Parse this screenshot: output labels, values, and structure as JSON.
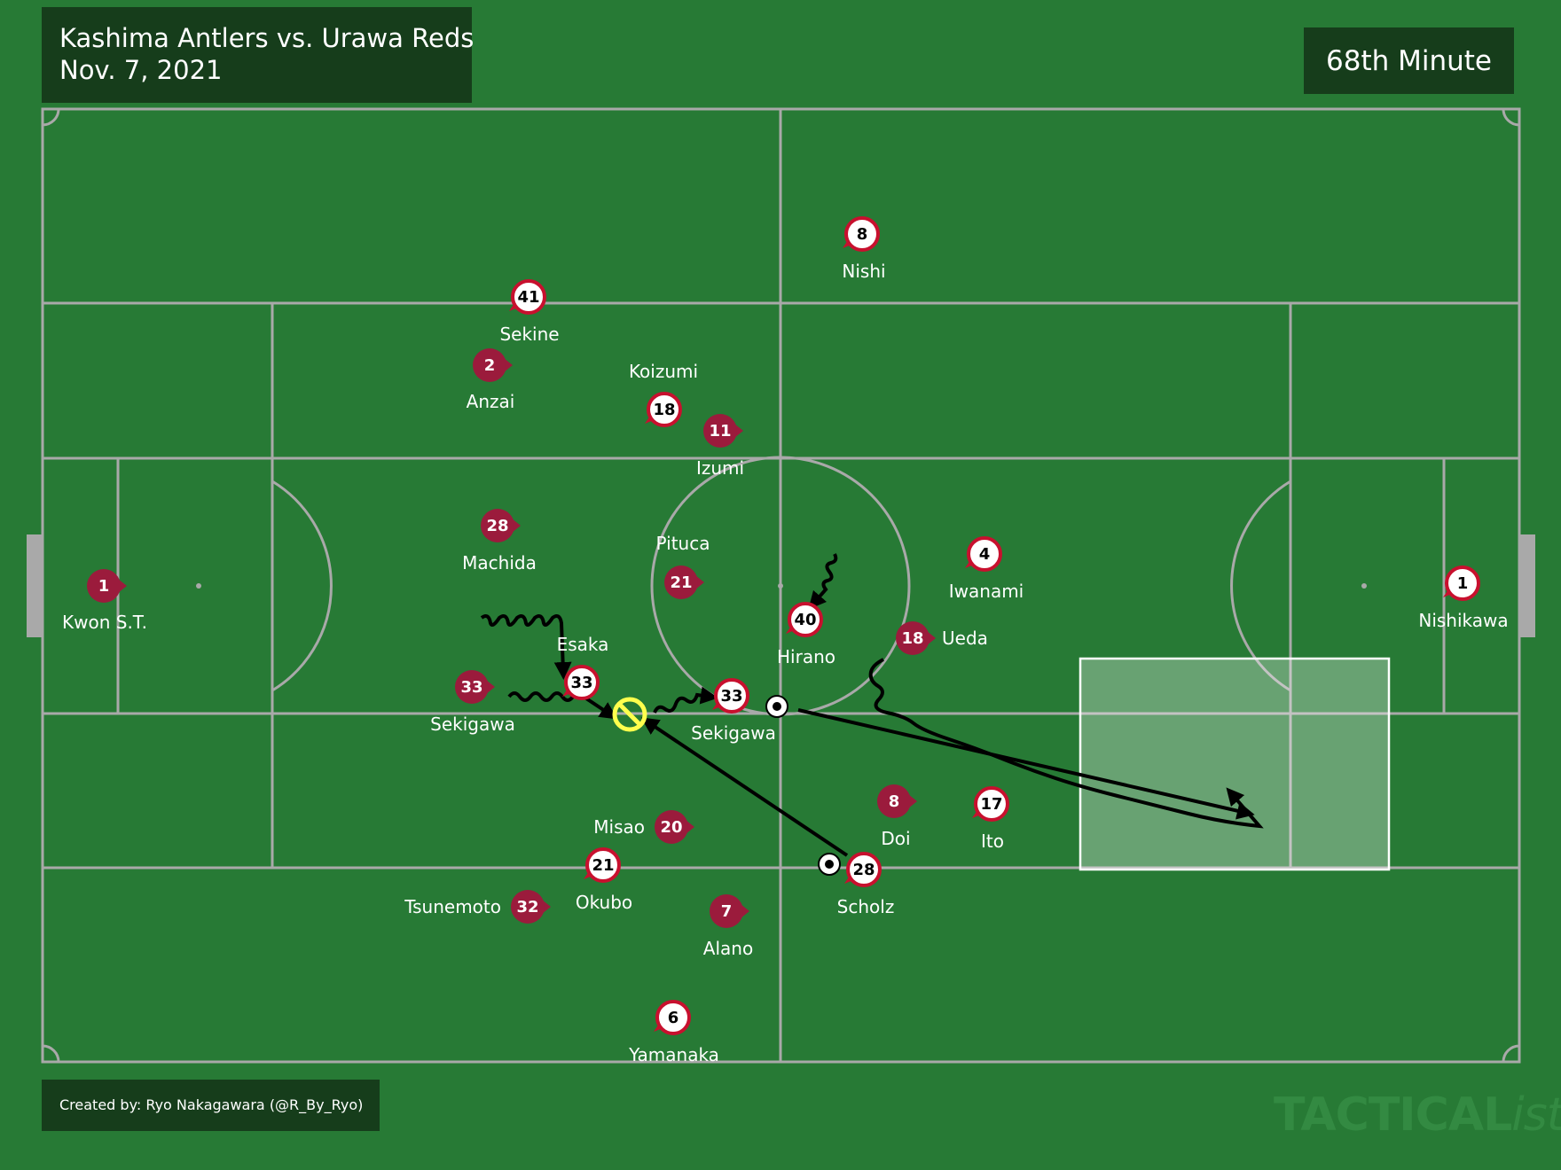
{
  "header": {
    "match": "Kashima Antlers vs. Urawa Reds",
    "date": "Nov. 7, 2021",
    "minute": "68th Minute"
  },
  "footer": {
    "credit": "Created by: Ryo Nakagawara (@R_By_Ryo)",
    "watermark_main": "TACTICAL",
    "watermark_suffix": "ista"
  },
  "colors": {
    "grass": "#277a35",
    "lines": "#a9a9a9",
    "panel": "#163d1b",
    "kashima": "#9b1b3c",
    "urawa_fill": "#ffffff",
    "urawa_ring": "#c8102e",
    "highlight": "#ffff4d"
  },
  "kashima": [
    {
      "number": "1",
      "name": "Kwon S.T."
    },
    {
      "number": "2",
      "name": "Anzai"
    },
    {
      "number": "11",
      "name": "Izumi"
    },
    {
      "number": "28",
      "name": "Machida"
    },
    {
      "number": "21",
      "name": "Pituca"
    },
    {
      "number": "33",
      "name": "Sekigawa"
    },
    {
      "number": "18",
      "name": "Ueda"
    },
    {
      "number": "8",
      "name": "Doi"
    },
    {
      "number": "20",
      "name": "Misao"
    },
    {
      "number": "32",
      "name": "Tsunemoto"
    },
    {
      "number": "7",
      "name": "Alano"
    }
  ],
  "urawa": [
    {
      "number": "8",
      "name": "Nishi"
    },
    {
      "number": "41",
      "name": "Sekine"
    },
    {
      "number": "18",
      "name": "Koizumi"
    },
    {
      "number": "33",
      "name": "Esaka"
    },
    {
      "number": "40",
      "name": "Hirano"
    },
    {
      "number": "33",
      "name": "Sekigawa"
    },
    {
      "number": "4",
      "name": "Iwanami"
    },
    {
      "number": "1",
      "name": "Nishikawa"
    },
    {
      "number": "17",
      "name": "Ito"
    },
    {
      "number": "28",
      "name": "Scholz"
    },
    {
      "number": "21",
      "name": "Okubo"
    },
    {
      "number": "6",
      "name": "Yamanaka"
    }
  ]
}
